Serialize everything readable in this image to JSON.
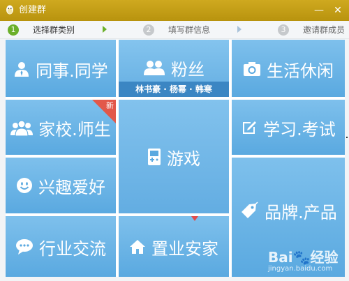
{
  "window": {
    "title": "创建群",
    "minimize_symbol": "—",
    "close_symbol": "✕"
  },
  "steps": [
    {
      "number": "1",
      "label": "选择群类别",
      "state": "active"
    },
    {
      "number": "2",
      "label": "填写群信息",
      "state": "inactive"
    },
    {
      "number": "3",
      "label": "邀请群成员",
      "state": "inactive"
    }
  ],
  "tiles": {
    "colleague": {
      "label": "同事.同学",
      "icon": "person-icon"
    },
    "fans": {
      "label": "粉丝",
      "icon": "people-icon",
      "subtitle": "林书豪 · 杨幂 · 韩寒"
    },
    "life": {
      "label": "生活休闲",
      "icon": "camera-icon"
    },
    "school": {
      "label": "家校.师生",
      "icon": "group-icon",
      "badge": "新"
    },
    "game": {
      "label": "游戏",
      "icon": "gamepad-icon"
    },
    "study": {
      "label": "学习.考试",
      "icon": "edit-icon"
    },
    "hobby": {
      "label": "兴趣爱好",
      "icon": "smile-icon"
    },
    "brand": {
      "label": "品牌.产品",
      "icon": "tag-icon"
    },
    "industry": {
      "label": "行业交流",
      "icon": "chat-icon"
    },
    "house": {
      "label": "置业安家",
      "icon": "home-icon"
    }
  },
  "watermark": {
    "text": "Bai🐾经验",
    "sub": "jingyan.baidu.com"
  },
  "colors": {
    "titlebar": "#c29e17",
    "tile": "#6ab4e6",
    "step_active": "#6bb02a",
    "badge": "#e2584a"
  }
}
